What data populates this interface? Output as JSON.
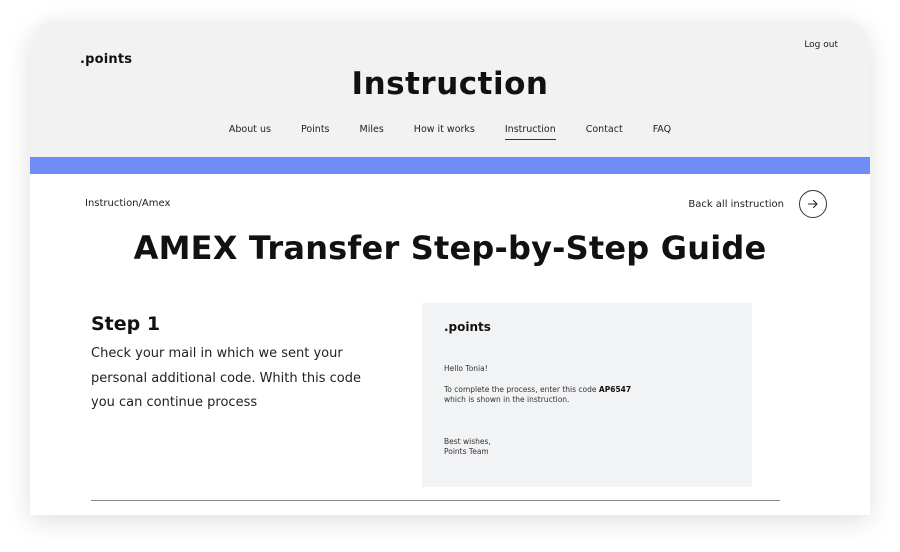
{
  "header": {
    "logo": ".points",
    "logout_label": "Log out",
    "page_heading": "Instruction",
    "nav": [
      {
        "label": "About us",
        "active": false
      },
      {
        "label": "Points",
        "active": false
      },
      {
        "label": "Miles",
        "active": false
      },
      {
        "label": "How it works",
        "active": false
      },
      {
        "label": "Instruction",
        "active": true
      },
      {
        "label": "Contact",
        "active": false
      },
      {
        "label": "FAQ",
        "active": false
      }
    ]
  },
  "colors": {
    "accent_bar": "#6f8cf7",
    "header_bg": "#f2f2f2",
    "card_bg": "#f2f3f5"
  },
  "breadcrumb": "Instruction/Amex",
  "back_link": {
    "label": "Back all instruction",
    "icon": "arrow-right-icon"
  },
  "guide_title": "AMEX Transfer Step-by-Step Guide",
  "step": {
    "title": "Step 1",
    "description": "Check your mail in which we sent your personal additional code. Whith this code you can continue process"
  },
  "email_card": {
    "logo": ".points",
    "greeting": "Hello Tonia!",
    "body_prefix": "To complete the process, enter this code ",
    "code": "AP6547",
    "body_suffix": "which is shown in the instruction.",
    "signoff_line1": "Best wishes,",
    "signoff_line2": "Points Team"
  }
}
